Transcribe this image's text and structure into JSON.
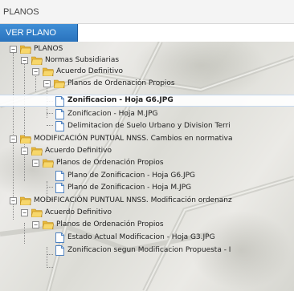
{
  "panel": {
    "title": "PLANOS"
  },
  "toolbar": {
    "ver_plano": "VER PLANO"
  },
  "tree": {
    "root": "PLANOS",
    "g1": {
      "label": "Normas Subsidiarias",
      "sub": "Acuerdo Definitivo",
      "subsub": "Planos de Ordenación Propios",
      "files": [
        "Zonificacion - Hoja G6.JPG",
        "Zonificacion - Hoja M.JPG",
        "Delimitacion de Suelo Urbano y Division Terri"
      ]
    },
    "g2": {
      "label": "MODIFICACIÓN PUNTUAL NNSS. Cambios en normativa",
      "sub": "Acuerdo Definitivo",
      "subsub": "Planos de Ordenación Propios",
      "files": [
        "Plano de Zonificacion - Hoja G6.JPG",
        "Plano de Zonificacion - Hoja M.JPG"
      ]
    },
    "g3": {
      "label": "MODIFICACIÓN PUNTUAL NNSS. Modificación ordenanz",
      "sub": "Acuerdo Definitivo",
      "subsub": "Planos de Ordenación Propios",
      "files": [
        "Estado Actual Modificacion - Hoja G3.JPG",
        "Zonificacion segun Modificacion Propuesta - I"
      ]
    },
    "toggle_symbol": "−"
  },
  "colors": {
    "accent": "#2a73bd",
    "folder": "#f2c94c",
    "selected_border": "#c7d9ef"
  },
  "icons": {
    "folder": "folder-open-icon",
    "file": "file-icon",
    "toggle": "collapse-toggle-icon"
  }
}
